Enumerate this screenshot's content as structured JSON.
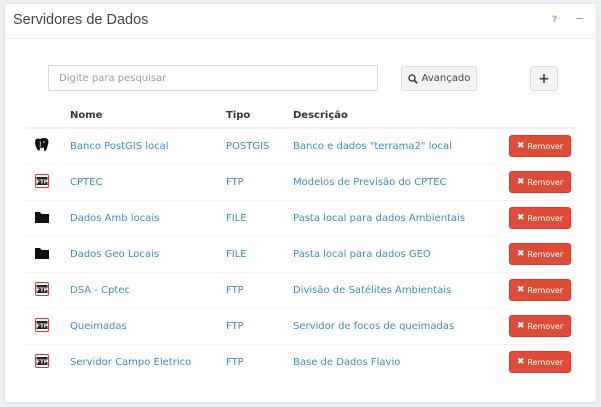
{
  "panel": {
    "title": "Servidores de Dados",
    "help_glyph": "?",
    "minimize_glyph": "−"
  },
  "toolbar": {
    "search_placeholder": "Digite para pesquisar",
    "advanced_label": "Avançado",
    "add_label": "+"
  },
  "table": {
    "headers": {
      "name": "Nome",
      "type": "Tipo",
      "description": "Descrição"
    },
    "remove_label": "Remover",
    "rows": [
      {
        "icon": "postgresql-elephant-icon",
        "name": "Banco PostGIS local",
        "type": "POSTGIS",
        "description": "Banco e dados \"terrama2\" local"
      },
      {
        "icon": "ftp-icon",
        "name": "CPTEC",
        "type": "FTP",
        "description": "Modelos de Previsão do CPTEC"
      },
      {
        "icon": "folder-icon",
        "name": "Dados Amb locais",
        "type": "FILE",
        "description": "Pasta local para dados Ambientais"
      },
      {
        "icon": "folder-icon",
        "name": "Dados Geo Locais",
        "type": "FILE",
        "description": "Pasta local para dados GEO"
      },
      {
        "icon": "ftp-icon",
        "name": "DSA - Cptec",
        "type": "FTP",
        "description": "Divisão de Satélites Ambientais"
      },
      {
        "icon": "ftp-icon",
        "name": "Queimadas",
        "type": "FTP",
        "description": "Servidor de focos de queimadas"
      },
      {
        "icon": "ftp-icon",
        "name": "Servidor Campo Eletrico",
        "type": "FTP",
        "description": "Base de Dados Flavio"
      }
    ]
  },
  "colors": {
    "link": "#3c8dbc",
    "danger": "#dd4b39"
  }
}
